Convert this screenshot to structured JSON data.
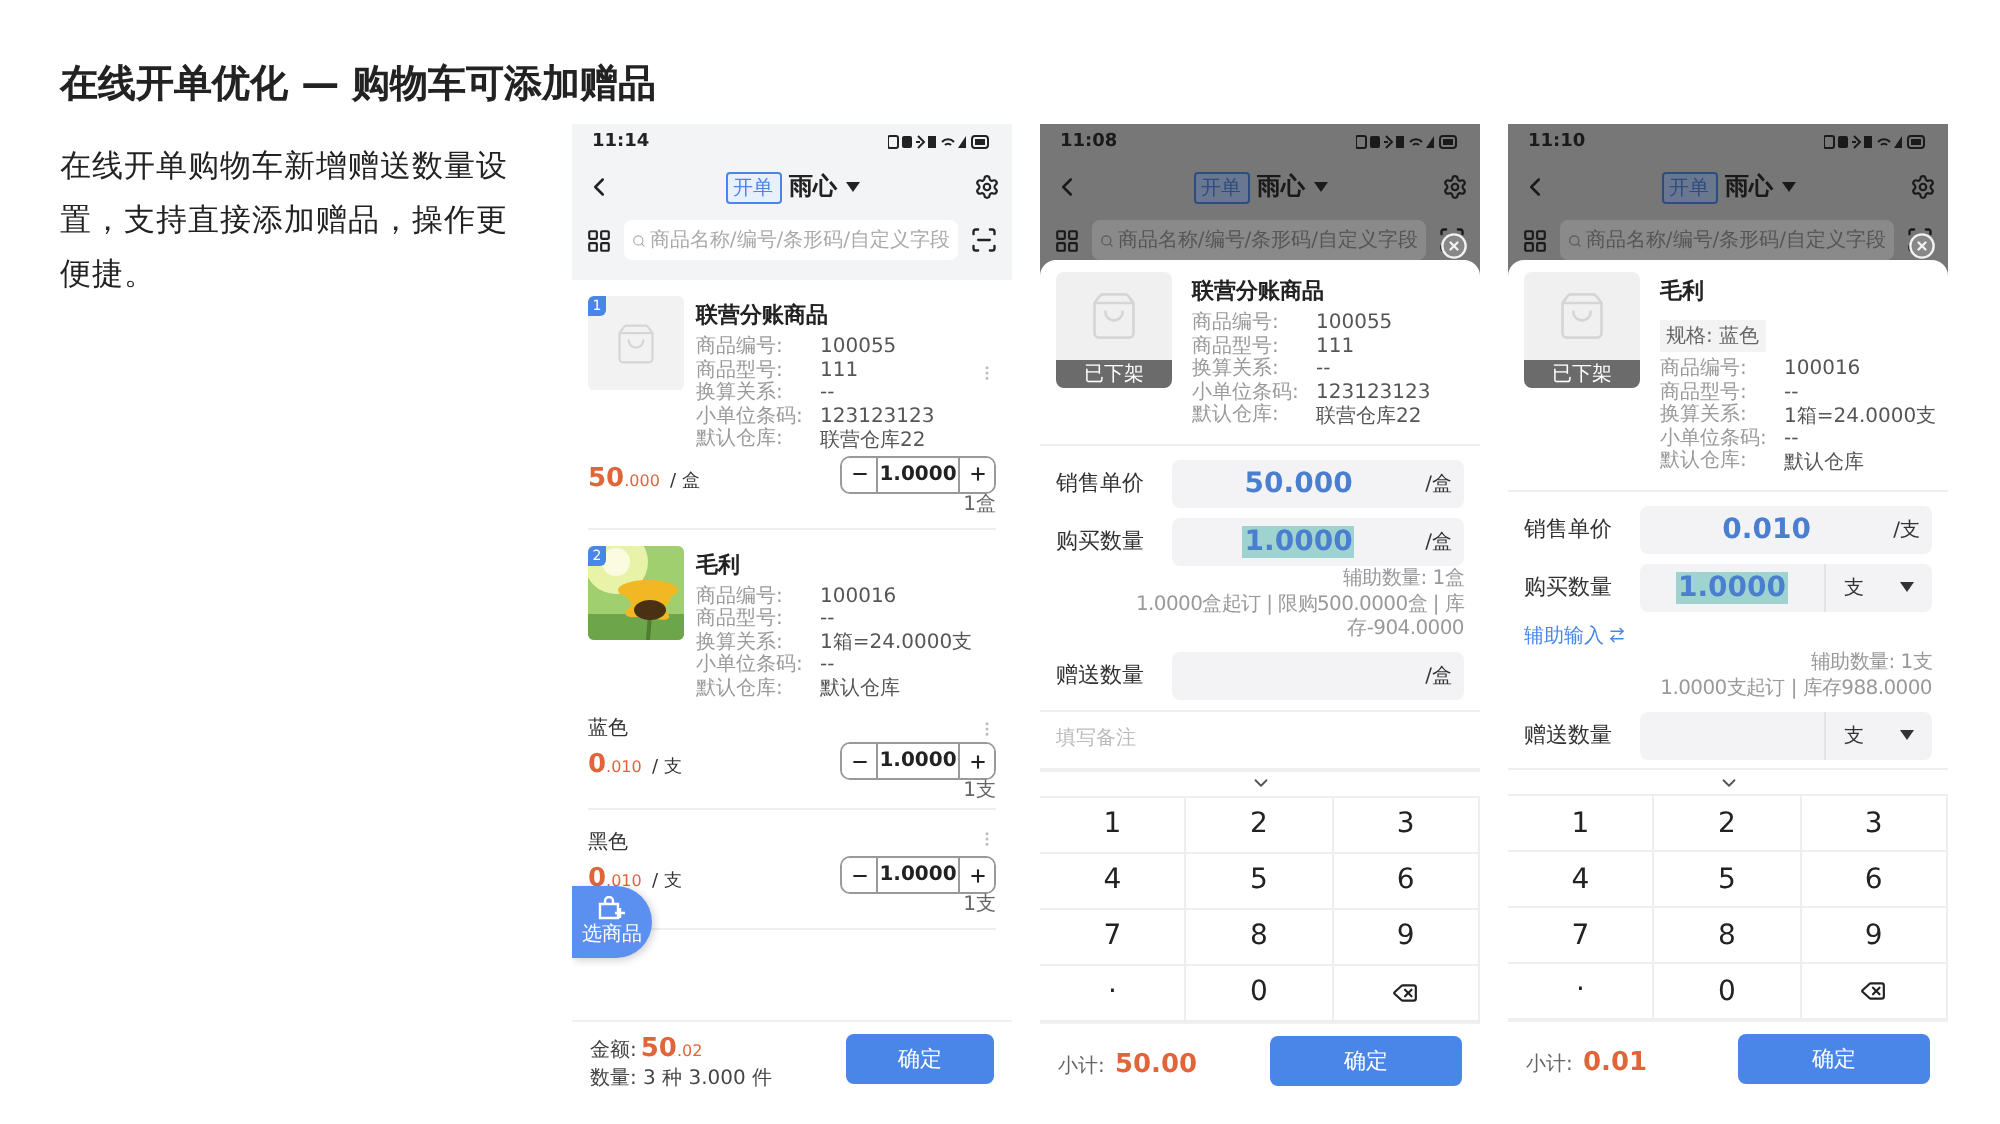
{
  "title": "在线开单优化 — 购物车可添加赠品",
  "description": "在线开单购物车新增赠送数量设置，支持直接添加赠品，操作更便捷。",
  "phones": [
    {
      "kind": "cart",
      "time": "11:14",
      "dimmed": false,
      "tag": "开单",
      "store": "雨心",
      "search_placeholder": "商品名称/编号/条形码/自定义字段",
      "items": [
        {
          "index": "1",
          "kind": "blank",
          "name": "联营分账商品",
          "fields": [
            {
              "label": "商品编号:",
              "value": "100055"
            },
            {
              "label": "商品型号:",
              "value": "111"
            },
            {
              "label": "换算关系:",
              "value": "--"
            },
            {
              "label": "小单位条码:",
              "value": "123123123"
            },
            {
              "label": "默认仓库:",
              "value": "联营仓库22"
            }
          ],
          "lines": [
            {
              "price_int": "50",
              "price_dec": ".000",
              "unit": "/ 盒",
              "qty": "1.0000",
              "qty_note": "1盒"
            }
          ]
        },
        {
          "index": "2",
          "name": "毛利",
          "fields": [
            {
              "label": "商品编号:",
              "value": "100016"
            },
            {
              "label": "商品型号:",
              "value": "--"
            },
            {
              "label": "换算关系:",
              "value": "1箱=24.0000支"
            },
            {
              "label": "小单位条码:",
              "value": "--"
            },
            {
              "label": "默认仓库:",
              "value": "默认仓库"
            }
          ],
          "lines": [
            {
              "label": "蓝色",
              "price_int": "0",
              "price_dec": ".010",
              "unit": "/ 支",
              "qty": "1.0000",
              "qty_note": "1支"
            },
            {
              "label": "黑色",
              "price_int": "0",
              "price_dec": ".010",
              "unit": "/ 支",
              "qty": "1.0000",
              "qty_note": "1支"
            }
          ]
        }
      ],
      "fab": "选商品",
      "amount_label": "金额:",
      "amount_int": "50",
      "amount_dec": ".02",
      "count": "数量: 3 种 3.000 件",
      "confirm": "确定"
    },
    {
      "kind": "sheet",
      "time": "11:08",
      "dimmed": true,
      "tag": "开单",
      "store": "雨心",
      "search_placeholder": "商品名称/编号/条形码/自定义字段",
      "product": {
        "name": "联营分账商品",
        "status": "已下架",
        "fields": [
          {
            "label": "商品编号:",
            "value": "100055"
          },
          {
            "label": "商品型号:",
            "value": "111"
          },
          {
            "label": "换算关系:",
            "value": "--"
          },
          {
            "label": "小单位条码:",
            "value": "123123123"
          },
          {
            "label": "默认仓库:",
            "value": "联营仓库22"
          }
        ]
      },
      "price": {
        "label": "销售单价",
        "value": "50.000",
        "unit": "/盒",
        "dropdown": false
      },
      "qty": {
        "label": "购买数量",
        "value": "1.0000",
        "highlighted": true,
        "unit": "/盒",
        "dropdown": false
      },
      "notes": [
        "辅助数量: 1盒",
        "1.0000盒起订 | 限购500.0000盒 | 库存-904.0000"
      ],
      "gift": {
        "label": "赠送数量",
        "unit": "/盒",
        "dropdown": false
      },
      "remark_placeholder": "填写备注",
      "keys": [
        {
          "kind": "key",
          "label": "1"
        },
        {
          "kind": "key",
          "label": "2"
        },
        {
          "kind": "key",
          "label": "3"
        },
        {
          "kind": "key",
          "label": "4"
        },
        {
          "kind": "key",
          "label": "5"
        },
        {
          "kind": "key",
          "label": "6"
        },
        {
          "kind": "key",
          "label": "7"
        },
        {
          "kind": "key",
          "label": "8"
        },
        {
          "kind": "key",
          "label": "9"
        },
        {
          "kind": "key",
          "label": "."
        },
        {
          "kind": "key",
          "label": "0"
        },
        {
          "kind": "backspace"
        }
      ],
      "subtotal_label": "小计:",
      "subtotal": "50.00",
      "confirm": "确定"
    },
    {
      "kind": "sheet",
      "time": "11:10",
      "dimmed": true,
      "tag": "开单",
      "store": "雨心",
      "search_placeholder": "商品名称/编号/条形码/自定义字段",
      "product": {
        "name": "毛利",
        "spec": "规格: 蓝色",
        "status": "已下架",
        "fields": [
          {
            "label": "商品编号:",
            "value": "100016"
          },
          {
            "label": "商品型号:",
            "value": "--"
          },
          {
            "label": "换算关系:",
            "value": "1箱=24.0000支"
          },
          {
            "label": "小单位条码:",
            "value": "--"
          },
          {
            "label": "默认仓库:",
            "value": "默认仓库"
          }
        ]
      },
      "price": {
        "label": "销售单价",
        "value": "0.010",
        "unit": "/支",
        "dropdown": false
      },
      "qty": {
        "label": "购买数量",
        "value": "1.0000",
        "highlighted": true,
        "unit": "支",
        "dropdown": true
      },
      "helper_link": "辅助输入",
      "notes": [
        "辅助数量: 1支",
        "1.0000支起订 | 库存988.0000"
      ],
      "gift": {
        "label": "赠送数量",
        "unit": "支",
        "dropdown": true
      },
      "keys": [
        {
          "kind": "key",
          "label": "1"
        },
        {
          "kind": "key",
          "label": "2"
        },
        {
          "kind": "key",
          "label": "3"
        },
        {
          "kind": "key",
          "label": "4"
        },
        {
          "kind": "key",
          "label": "5"
        },
        {
          "kind": "key",
          "label": "6"
        },
        {
          "kind": "key",
          "label": "7"
        },
        {
          "kind": "key",
          "label": "8"
        },
        {
          "kind": "key",
          "label": "9"
        },
        {
          "kind": "key",
          "label": "."
        },
        {
          "kind": "key",
          "label": "0"
        },
        {
          "kind": "backspace"
        }
      ],
      "subtotal_label": "小计:",
      "subtotal": "0.01",
      "confirm": "确定"
    }
  ]
}
